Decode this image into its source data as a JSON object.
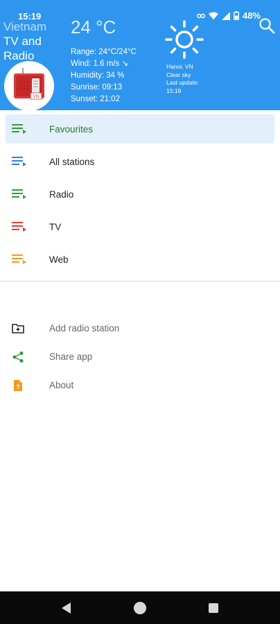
{
  "status": {
    "time": "15:19",
    "battery": "48%"
  },
  "header": {
    "title_line1": "Vietnam",
    "title_line2": "TV and",
    "title_line3": "Radio",
    "temperature": "24 °C",
    "range": "Range: 24°C/24°C",
    "wind": "Wind: 1.6 m/s ↘",
    "humidity": "Humidity: 34 %",
    "sunrise": "Sunrise: 09:13",
    "sunset": "Sunset: 21:02",
    "location": "Hanoi, VN",
    "condition": "Clear sky",
    "last_update_label": "Last update:",
    "last_update_time": "15:19",
    "logo_text": "VN"
  },
  "menu": {
    "items": [
      {
        "label": "Favourites",
        "color": "#2e9d3a"
      },
      {
        "label": "All stations",
        "color": "#2f80e0"
      },
      {
        "label": "Radio",
        "color": "#2e9d3a"
      },
      {
        "label": "TV",
        "color": "#e53935"
      },
      {
        "label": "Web",
        "color": "#f29a1e"
      }
    ]
  },
  "secondary": {
    "add_station": "Add radio station",
    "share_app": "Share app",
    "about": "About"
  },
  "colors": {
    "header_bg": "#2f96ef",
    "active_bg": "#e3f0fb",
    "share": "#2e9d3a",
    "about": "#f29a1e"
  }
}
